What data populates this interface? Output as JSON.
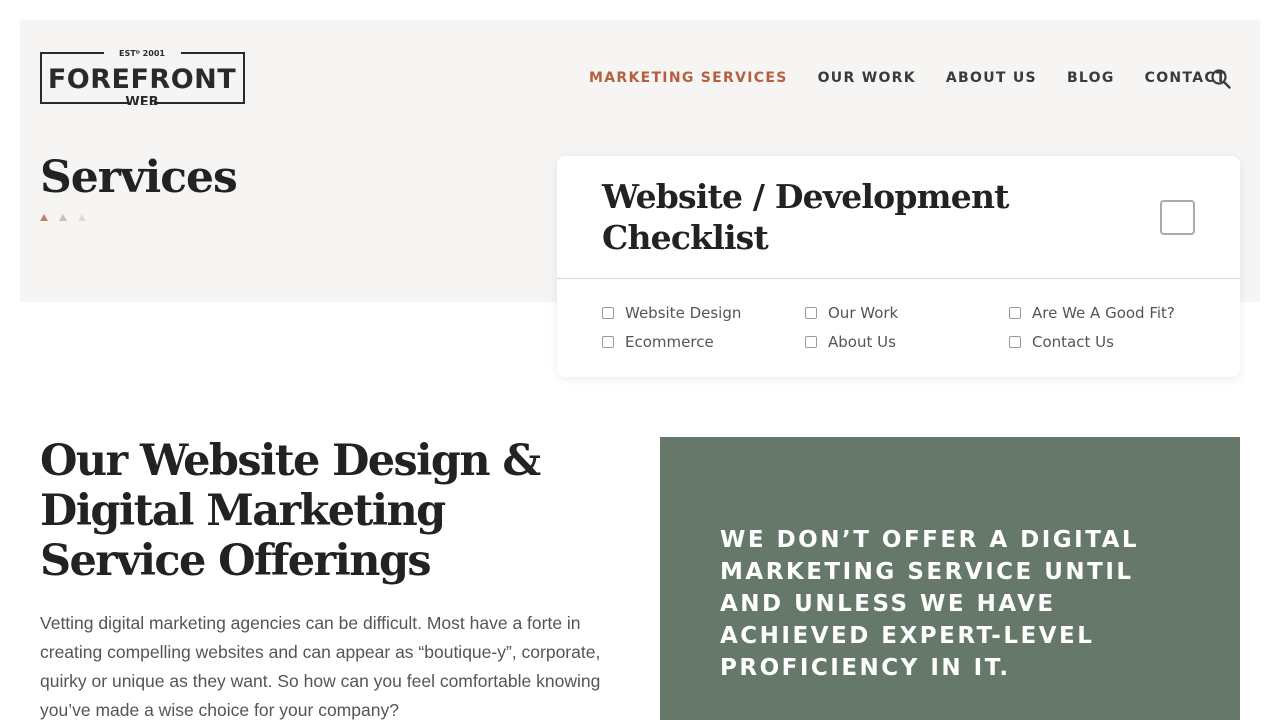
{
  "logo": {
    "estd": "ESTᴰ 2001",
    "name": "FOREFRONT",
    "sub": "WEB"
  },
  "nav": {
    "items": [
      {
        "label": "MARKETING SERVICES",
        "active": true
      },
      {
        "label": "OUR WORK"
      },
      {
        "label": "ABOUT US"
      },
      {
        "label": "BLOG"
      },
      {
        "label": "CONTACT"
      }
    ],
    "search_icon": "search-icon",
    "active_color": "#b5603e"
  },
  "page": {
    "title": "Services"
  },
  "checklist": {
    "title": "Website / Development Checklist",
    "items": [
      "Website Design",
      "Our Work",
      "Are We A Good Fit?",
      "Ecommerce",
      "About Us",
      "Contact Us"
    ]
  },
  "main": {
    "heading": "Our Website Design & Digital Marketing Service Offerings",
    "body": "Vetting digital marketing agencies can be difficult. Most have a forte in creating compelling websites and can appear as “boutique-y”, corporate, quirky or unique as they want. So how can you feel comfortable knowing you’ve made a wise choice for your company?"
  },
  "callout": {
    "text": "WE DON’T OFFER A DIGITAL MARKETING SERVICE UNTIL AND UNLESS WE HAVE ACHIEVED EXPERT-LEVEL PROFICIENCY IN IT.",
    "bg_color": "#65786a"
  }
}
